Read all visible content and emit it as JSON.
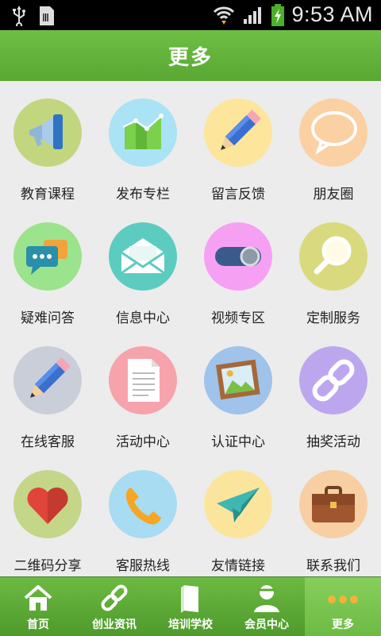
{
  "status_bar": {
    "time": "9:53 AM"
  },
  "header": {
    "title": "更多"
  },
  "grid": [
    {
      "label": "教育课程",
      "icon": "megaphone-icon",
      "color": "#c2d67f"
    },
    {
      "label": "发布专栏",
      "icon": "chart-icon",
      "color": "#a9e3f5"
    },
    {
      "label": "留言反馈",
      "icon": "pencil-icon",
      "color": "#fde59c"
    },
    {
      "label": "朋友圈",
      "icon": "speech-bubble-icon",
      "color": "#fbd0a2"
    },
    {
      "label": "疑难问答",
      "icon": "chat-icon",
      "color": "#9ce38d"
    },
    {
      "label": "信息中心",
      "icon": "envelope-icon",
      "color": "#5dccc0"
    },
    {
      "label": "视频专区",
      "icon": "toggle-icon",
      "color": "#f6a0f4"
    },
    {
      "label": "定制服务",
      "icon": "magnifier-icon",
      "color": "#d9da7d"
    },
    {
      "label": "在线客服",
      "icon": "pencil-icon",
      "color": "#c9ced9"
    },
    {
      "label": "活动中心",
      "icon": "document-icon",
      "color": "#f7a3ac"
    },
    {
      "label": "认证中心",
      "icon": "picture-icon",
      "color": "#9fc3ea"
    },
    {
      "label": "抽奖活动",
      "icon": "link-icon",
      "color": "#bca7ef"
    },
    {
      "label": "二维码分享",
      "icon": "heart-icon",
      "color": "#c4d688"
    },
    {
      "label": "客服热线",
      "icon": "phone-icon",
      "color": "#a7dcf2"
    },
    {
      "label": "友情链接",
      "icon": "paper-plane-icon",
      "color": "#fbe59d"
    },
    {
      "label": "联系我们",
      "icon": "briefcase-icon",
      "color": "#f8cea3"
    }
  ],
  "bottom_nav": [
    {
      "label": "首页",
      "icon": "home-icon"
    },
    {
      "label": "创业资讯",
      "icon": "link-icon"
    },
    {
      "label": "培训学校",
      "icon": "book-icon"
    },
    {
      "label": "会员中心",
      "icon": "user-icon"
    },
    {
      "label": "更多",
      "icon": "more-dots-icon",
      "active": true
    }
  ]
}
